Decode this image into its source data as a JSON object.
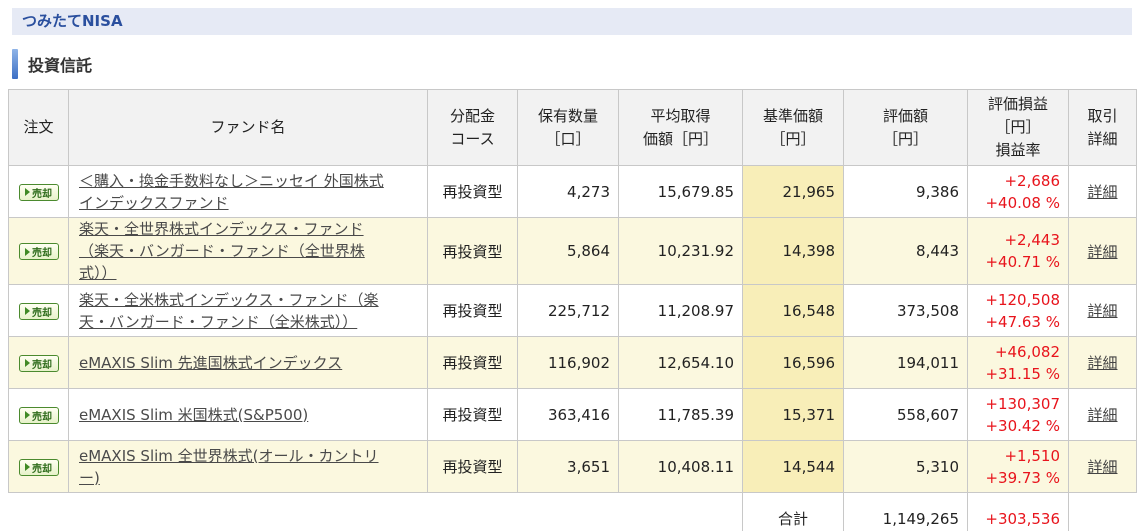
{
  "account": {
    "title": "つみたてNISA"
  },
  "section": {
    "title": "投資信託"
  },
  "table": {
    "headers": {
      "order": "注文",
      "fund_name": "ファンド名",
      "course_l1": "分配金",
      "course_l2": "コース",
      "quantity_l1": "保有数量",
      "quantity_l2": "［口］",
      "avg_cost_l1": "平均取得",
      "avg_cost_l2": "価額［円］",
      "nav_l1": "基準価額",
      "nav_l2": "［円］",
      "value_l1": "評価額",
      "value_l2": "［円］",
      "gain_l1": "評価損益",
      "gain_l2": "［円］",
      "gain_l3": "損益率",
      "detail_l1": "取引",
      "detail_l2": "詳細"
    },
    "sell_label": "売却",
    "detail_label": "詳細",
    "rows": [
      {
        "fund_l1": "＜購入・換金手数料なし＞ニッセイ 外国株式",
        "fund_l2": "インデックスファンド",
        "fund_l3": "",
        "course": "再投資型",
        "quantity": "4,273",
        "avg_cost": "15,679.85",
        "nav": "21,965",
        "value": "9,386",
        "gain": "+2,686",
        "gain_rate": "+40.08 %"
      },
      {
        "fund_l1": "楽天・全世界株式インデックス・ファンド",
        "fund_l2": "（楽天・バンガード・ファンド（全世界株",
        "fund_l3": "式））",
        "course": "再投資型",
        "quantity": "5,864",
        "avg_cost": "10,231.92",
        "nav": "14,398",
        "value": "8,443",
        "gain": "+2,443",
        "gain_rate": "+40.71 %"
      },
      {
        "fund_l1": "楽天・全米株式インデックス・ファンド（楽",
        "fund_l2": "天・バンガード・ファンド（全米株式））",
        "fund_l3": "",
        "course": "再投資型",
        "quantity": "225,712",
        "avg_cost": "11,208.97",
        "nav": "16,548",
        "value": "373,508",
        "gain": "+120,508",
        "gain_rate": "+47.63 %"
      },
      {
        "fund_l1": "eMAXIS Slim 先進国株式インデックス",
        "fund_l2": "",
        "fund_l3": "",
        "course": "再投資型",
        "quantity": "116,902",
        "avg_cost": "12,654.10",
        "nav": "16,596",
        "value": "194,011",
        "gain": "+46,082",
        "gain_rate": "+31.15 %"
      },
      {
        "fund_l1": "eMAXIS Slim 米国株式(S&P500)",
        "fund_l2": "",
        "fund_l3": "",
        "course": "再投資型",
        "quantity": "363,416",
        "avg_cost": "11,785.39",
        "nav": "15,371",
        "value": "558,607",
        "gain": "+130,307",
        "gain_rate": "+30.42 %"
      },
      {
        "fund_l1": "eMAXIS Slim 全世界株式(オール・カントリ",
        "fund_l2": "ー)",
        "fund_l3": "",
        "course": "再投資型",
        "quantity": "3,651",
        "avg_cost": "10,408.11",
        "nav": "14,544",
        "value": "5,310",
        "gain": "+1,510",
        "gain_rate": "+39.73 %"
      }
    ],
    "total": {
      "label": "合計",
      "value": "1,149,265",
      "gain": "+303,536"
    }
  },
  "colors": {
    "account_bar_bg": "#e6eaf5",
    "account_title": "#2a4f9e",
    "row_alt_bg": "#fbf8df",
    "nav_cell_bg": "#f8eeb8",
    "gain_text": "#e8141c",
    "sell_button_border": "#4b8a2e"
  }
}
